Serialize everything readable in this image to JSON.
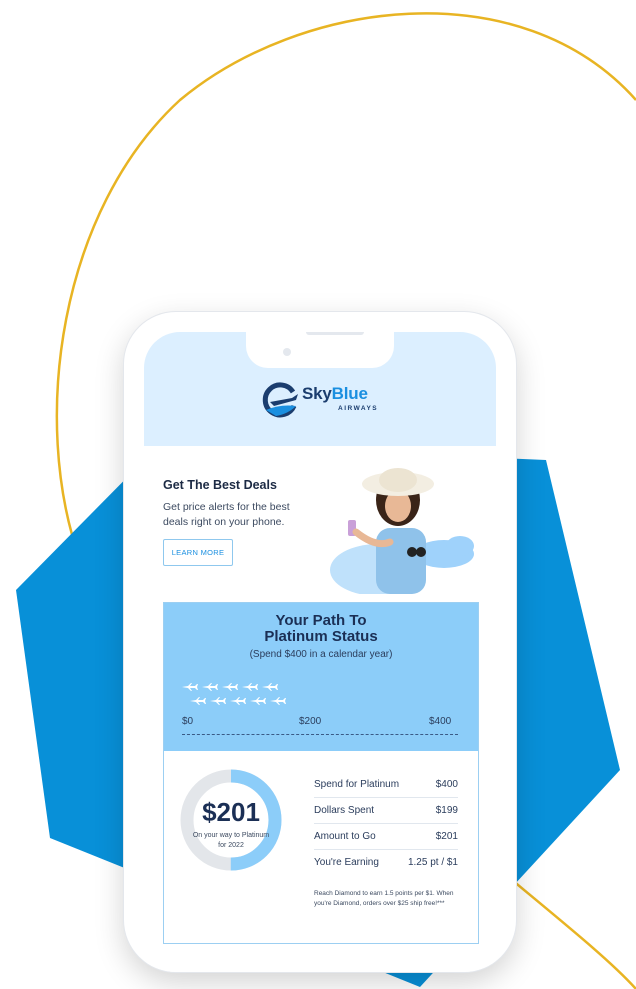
{
  "colors": {
    "gold": "#e8b423",
    "hexagon_blue": "#0890d8",
    "header_bg": "#dcefff",
    "path_bg": "#8ccdf9",
    "navy": "#1b2f55",
    "accent": "#1a8fe0"
  },
  "logo": {
    "sky": "Sky",
    "blue": "Blue",
    "sub": "AIRWAYS",
    "icon": "plane-circle-icon"
  },
  "promo": {
    "title": "Get The Best Deals",
    "text": "Get price alerts for the best deals right on your phone.",
    "button": "LEARN MORE"
  },
  "path": {
    "title_line1": "Your Path To",
    "title_line2": "Platinum Status",
    "subtitle": "(Spend $400 in a calendar year)",
    "scale": [
      "$0",
      "$200",
      "$400"
    ],
    "progress_fraction": 0.5
  },
  "donut": {
    "value": "$201",
    "caption": "On your way to Platinum for 2022",
    "fill_fraction": 0.5
  },
  "stats": [
    {
      "label": "Spend for Platinum",
      "value": "$400"
    },
    {
      "label": "Dollars Spent",
      "value": "$199"
    },
    {
      "label": "Amount to Go",
      "value": "$201"
    },
    {
      "label": "You're Earning",
      "value": "1.25 pt / $1"
    }
  ],
  "fine_print": "Reach Diamond to earn 1.5 points per $1. When you're Diamond, orders over $25 ship free!***"
}
